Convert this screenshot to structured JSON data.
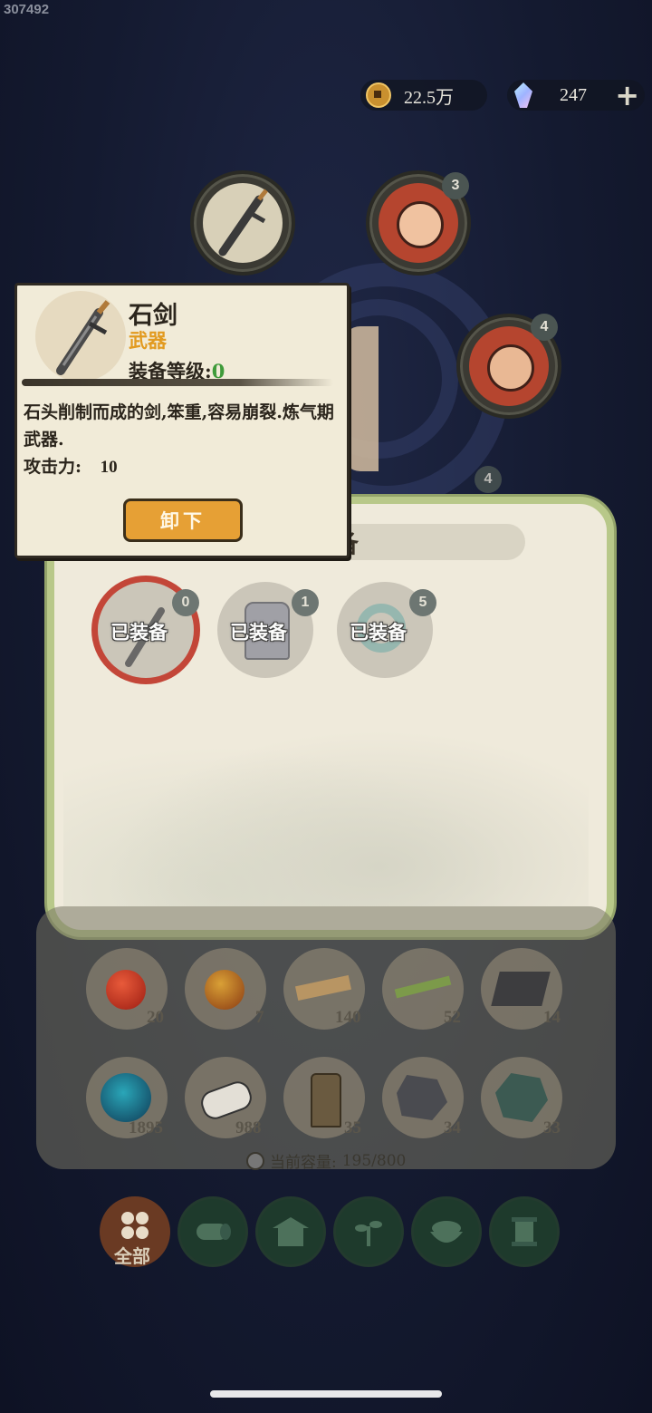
{
  "watermark": "307492",
  "currency": {
    "coins": "22.5万",
    "gems": "247",
    "add_symbol": "+"
  },
  "slots": {
    "pet_top_badge": "3",
    "pet_right_badge": "4",
    "pet_lower_badge": "4"
  },
  "panel": {
    "title_partial": "备",
    "equipped": [
      {
        "label": "已装备",
        "badge": "0",
        "icon": "sword-icon"
      },
      {
        "label": "已装备",
        "badge": "1",
        "icon": "armor-icon"
      },
      {
        "label": "已装备",
        "badge": "5",
        "icon": "bracelet-icon"
      }
    ]
  },
  "inventory": {
    "items": [
      {
        "icon": "red-pill-icon",
        "count": "20"
      },
      {
        "icon": "gold-pill-icon",
        "count": "7"
      },
      {
        "icon": "wood-planks-icon",
        "count": "140"
      },
      {
        "icon": "bamboo-icon",
        "count": "52"
      },
      {
        "icon": "iron-ingot-icon",
        "count": "14"
      },
      {
        "icon": "spirit-orb-icon",
        "count": "1895"
      },
      {
        "icon": "stone-slab-icon",
        "count": "988"
      },
      {
        "icon": "token-icon",
        "count": "35"
      },
      {
        "icon": "black-rock-icon",
        "count": "34"
      },
      {
        "icon": "jade-ore-icon",
        "count": "33"
      }
    ],
    "capacity_label": "当前容量:",
    "capacity_value": "195/800"
  },
  "tabs": [
    {
      "icon": "all-grid-icon",
      "label": "全部",
      "active": true
    },
    {
      "icon": "log-icon",
      "label": ""
    },
    {
      "icon": "house-icon",
      "label": ""
    },
    {
      "icon": "herb-icon",
      "label": ""
    },
    {
      "icon": "rice-bowl-icon",
      "label": ""
    },
    {
      "icon": "scroll-icon",
      "label": ""
    }
  ],
  "tooltip": {
    "name": "石剑",
    "type": "武器",
    "level_label": "装备等级:",
    "level_value": "0",
    "description": "石头削制而成的剑,笨重,容易崩裂.炼气期武器.",
    "attack_label": "攻击力:",
    "attack_value": "10",
    "unequip_button": "卸下"
  },
  "colors": {
    "accent_orange": "#e6a035",
    "type_color": "#e29a1f",
    "level_green": "#3f9b3a",
    "panel_border": "#b8c889"
  }
}
